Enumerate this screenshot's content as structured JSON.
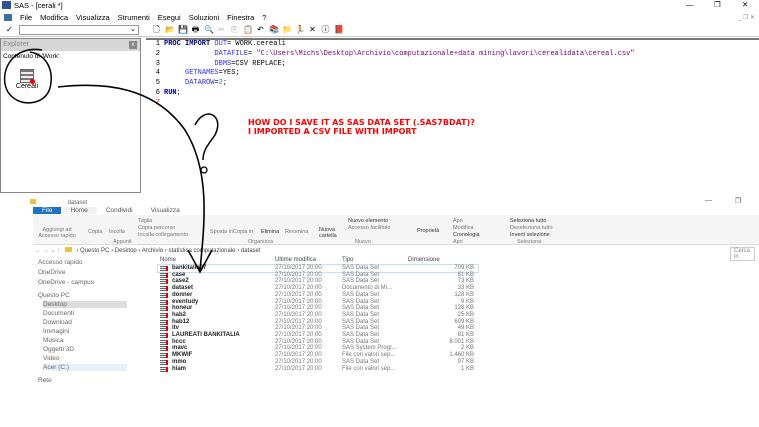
{
  "sas": {
    "title": "SAS - [cerali *]",
    "menu": [
      "File",
      "Modifica",
      "Visualizza",
      "Strumenti",
      "Esegui",
      "Soluzioni",
      "Finestra",
      "?"
    ],
    "explorer": {
      "title": "Explorer",
      "subtitle": "Contenuto di 'Work'",
      "item": "Cereali"
    },
    "code": [
      {
        "n": "1",
        "parts": [
          [
            "kw",
            "PROC IMPORT "
          ],
          [
            "bl",
            "OUT"
          ],
          [
            "",
            "= WORK.cereali"
          ]
        ]
      },
      {
        "n": "2",
        "parts": [
          [
            "",
            "            "
          ],
          [
            "bl",
            "DATAFILE"
          ],
          [
            "",
            "= "
          ],
          [
            "str",
            "\"C:\\Users\\Michs\\Desktop\\Archivio\\computazionale+data mining\\lavori\\cerealidata\\cereal.csv\""
          ]
        ]
      },
      {
        "n": "3",
        "parts": [
          [
            "",
            "            "
          ],
          [
            "bl",
            "DBMS"
          ],
          [
            "",
            "=CSV REPLACE;"
          ]
        ]
      },
      {
        "n": "4",
        "parts": [
          [
            "",
            "     "
          ],
          [
            "bl",
            "GETNAMES"
          ],
          [
            "",
            "=YES;"
          ]
        ]
      },
      {
        "n": "5",
        "parts": [
          [
            "",
            "     "
          ],
          [
            "bl",
            "DATAROW"
          ],
          [
            "",
            "="
          ],
          [
            "teal",
            "2"
          ],
          [
            "",
            ";"
          ]
        ]
      },
      {
        "n": "6",
        "parts": [
          [
            "kw",
            "RUN"
          ],
          [
            "",
            ";"
          ]
        ]
      },
      {
        "n": "7",
        "parts": []
      }
    ]
  },
  "question": [
    "HOW DO I SAVE IT AS SAS DATA SET (.SAS7BDAT)?",
    "I IMPORTED A CSV FILE WITH IMPORT"
  ],
  "fe": {
    "title": "dataset",
    "tabs": [
      "File",
      "Home",
      "Condividi",
      "Visualizza"
    ],
    "groups": {
      "appunti": "Appunti",
      "organizza": "Organizza",
      "nuovo": "Nuovo",
      "apri": "Apri",
      "seleziona": "Seleziona"
    },
    "buttons": {
      "pin": "Aggiungi ad Accesso rapido",
      "copia": "Copia",
      "incolla": "Incolla",
      "taglia": "Taglia",
      "copia_percorso": "Copia percorso",
      "incolla_coll": "Incolla collegamento",
      "sposta": "Sposta in",
      "copia_in": "Copia in",
      "elimina": "Elimina",
      "rinomina": "Rinomina",
      "nuova_cartella": "Nuova cartella",
      "nuovo_elemento": "Nuovo elemento",
      "accesso_facilitato": "Accesso facilitato",
      "proprieta": "Proprietà",
      "apri": "Apri",
      "modifica": "Modifica",
      "cronologia": "Cronologia",
      "sel_tutto": "Seleziona tutto",
      "desel_tutto": "Deseleziona tutto",
      "inverti": "Inverti selezione"
    },
    "path": [
      "Questo PC",
      "Desktop",
      "Archivio",
      "statistica computazionale",
      "dataset"
    ],
    "search": "Cerca in",
    "nav": [
      "Accesso rapido",
      "OneDrive",
      "OneDrive - campus",
      "Questo PC",
      "Desktop",
      "Documenti",
      "Download",
      "Immagini",
      "Musica",
      "Oggetti 3D",
      "Video",
      "Acer (C:)",
      "Rete"
    ],
    "cols": [
      "Nome",
      "Ultime modifica",
      "Tipo",
      "Dimensione"
    ],
    "files": [
      [
        "bankitalia97",
        "27/10/2017 20:00",
        "SAS Data Set",
        "709 KB"
      ],
      [
        "case",
        "27/10/2017 20:00",
        "SAS Data Set",
        "61 KB"
      ],
      [
        "case2",
        "27/10/2017 20:00",
        "SAS Data Set",
        "73 KB"
      ],
      [
        "dataset",
        "27/10/2017 20:00",
        "Documento di Mi...",
        "33 KB"
      ],
      [
        "donner",
        "27/10/2017 20:00",
        "SAS Data Set",
        "128 KB"
      ],
      [
        "eventudy",
        "27/10/2017 20:00",
        "SAS Data Set",
        "9 KB"
      ],
      [
        "honeur",
        "27/10/2017 20:00",
        "SAS Data Set",
        "128 KB"
      ],
      [
        "hab2",
        "27/10/2017 20:00",
        "SAS Data Set",
        "25 KB"
      ],
      [
        "hab12",
        "27/10/2017 20:00",
        "SAS Data Set",
        "609 KB"
      ],
      [
        "itv",
        "27/10/2017 20:00",
        "SAS Data Set",
        "49 KB"
      ],
      [
        "LAUREATI BANKITALIA",
        "27/10/2017 20:00",
        "SAS Data Set",
        "81 KB"
      ],
      [
        "hccc",
        "27/10/2017 20:00",
        "SAS Data Set",
        "8.001 KB"
      ],
      [
        "mavc",
        "27/10/2017 20:00",
        "SAS System Progr...",
        "2 KB"
      ],
      [
        "MKWIF",
        "27/10/2017 20:00",
        "File con valori sep...",
        "1.460 KB"
      ],
      [
        "mmo",
        "27/10/2017 20:00",
        "SAS Data Set",
        "97 KB"
      ],
      [
        "hiam",
        "27/10/2017 20:00",
        "File con valori sep...",
        "1 KB"
      ]
    ]
  }
}
